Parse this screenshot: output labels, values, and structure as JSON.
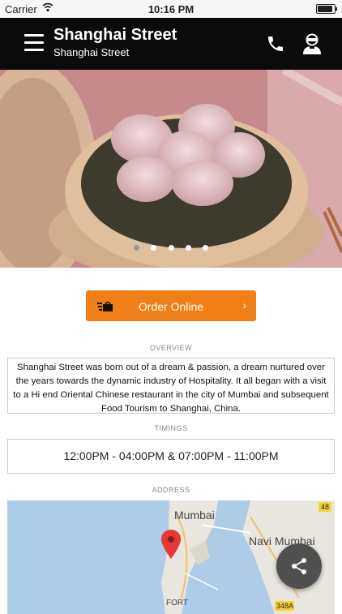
{
  "status_bar": {
    "carrier": "Carrier",
    "time": "10:16 PM"
  },
  "app_bar": {
    "title": "Shanghai Street",
    "subtitle": "Shanghai Street"
  },
  "hero": {
    "slides": 5,
    "active_slide": 1
  },
  "order": {
    "label": "Order Online"
  },
  "overview": {
    "heading": "OVERVIEW",
    "text": "Shanghai Street was born out of a dream & passion, a dream nurtured over the years towards the dynamic industry of Hospitality. It all began with a visit to a Hi end Oriental Chinese restaurant in the city of Mumbai and subsequent Food Tourism to Shanghai, China."
  },
  "timings": {
    "heading": "TIMINGS",
    "text": "12:00PM - 04:00PM & 07:00PM - 11:00PM"
  },
  "address": {
    "heading": "ADDRESS",
    "map_labels": {
      "city": "Mumbai",
      "city2": "Navi Mumbai",
      "area": "FORT",
      "road_badge": "48",
      "road_badge2": "348A"
    }
  },
  "colors": {
    "accent": "#f07f17",
    "app_bar": "#0b0b0b",
    "fab": "#505050"
  }
}
